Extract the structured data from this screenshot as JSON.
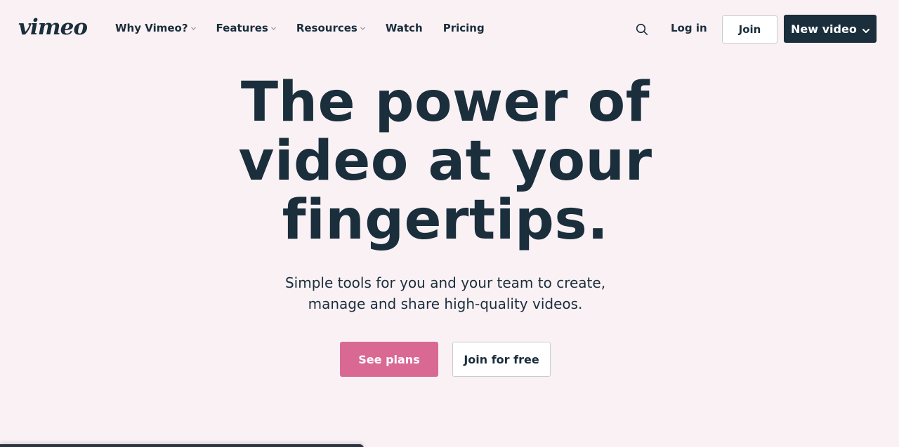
{
  "header": {
    "logo": "vimeo",
    "nav": [
      {
        "label": "Why Vimeo?",
        "has_dropdown": true
      },
      {
        "label": "Features",
        "has_dropdown": true
      },
      {
        "label": "Resources",
        "has_dropdown": true
      },
      {
        "label": "Watch",
        "has_dropdown": false
      },
      {
        "label": "Pricing",
        "has_dropdown": false
      }
    ],
    "search_icon": "search-icon",
    "login_label": "Log in",
    "join_label": "Join",
    "new_video_label": "New video",
    "new_video_icon": "chevron-down-icon"
  },
  "hero": {
    "title_lines": [
      "The power of",
      "video at your",
      "fingertips."
    ],
    "subtitle_lines": [
      "Simple tools for you and your team to create,",
      "manage and share high-quality videos."
    ],
    "primary_cta": "See plans",
    "secondary_cta": "Join for free"
  },
  "colors": {
    "background": "#faf1f5",
    "text": "#1a2e3b",
    "primary_button": "#d96993",
    "dark_button": "#1a2e3b"
  }
}
